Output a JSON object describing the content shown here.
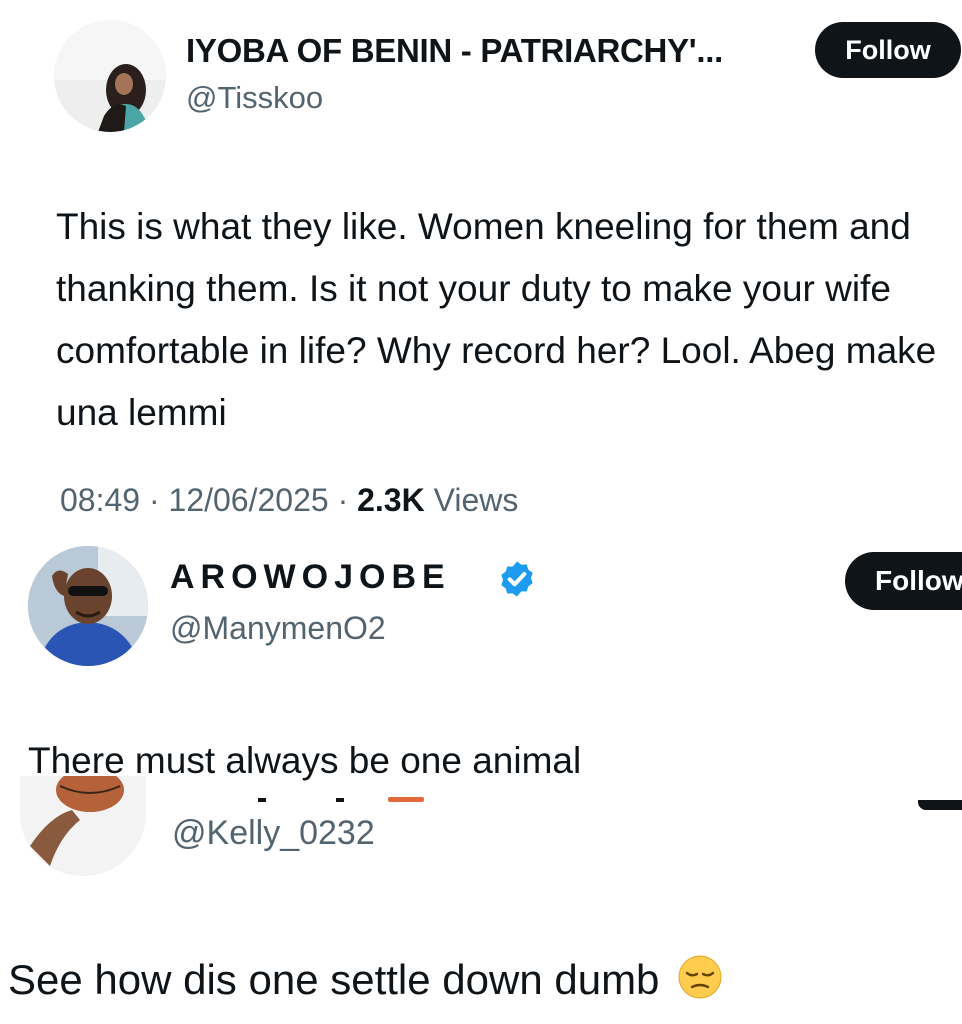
{
  "tweets": [
    {
      "display_name": "IYOBA OF BENIN - PATRIARCHY'...",
      "handle": "@Tisskoo",
      "follow_label": "Follow",
      "text": "This is what they like. Women kneeling for them and thanking them. Is it not your duty to make your wife comfortable in life? Why record her? Lool. Abeg make una lemmi",
      "time": "08:49",
      "date": "12/06/2025",
      "views_count": "2.3K",
      "views_label": "Views",
      "separator": "·"
    },
    {
      "display_name": "AROWOJOBE",
      "verified": true,
      "handle": "@ManymenO2",
      "follow_label": "Follow",
      "text": "There must always be one animal"
    },
    {
      "handle": "@Kelly_0232",
      "text": "See how dis one settle down dumb",
      "emoji": "pensive-face"
    }
  ],
  "colors": {
    "text_primary": "#0f1419",
    "text_secondary": "#536471",
    "follow_bg": "#0f1419",
    "verified_blue": "#1d9bf0"
  }
}
